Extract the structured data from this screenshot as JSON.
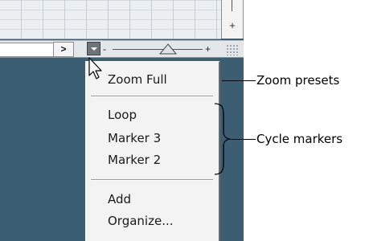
{
  "toolbar": {
    "scroll_right_glyph": ">",
    "zoom_minus": "-",
    "zoom_plus": "+",
    "zoom_level": 0.62,
    "vertical_zoom_plus": "+"
  },
  "menu": {
    "items": [
      {
        "label": "Zoom Full"
      },
      {
        "label": "Loop"
      },
      {
        "label": "Marker 3"
      },
      {
        "label": "Marker 2"
      },
      {
        "label": "Add"
      },
      {
        "label": "Organize..."
      }
    ]
  },
  "callouts": {
    "zoom_presets": "Zoom presets",
    "cycle_markers": "Cycle markers"
  },
  "colors": {
    "project_background": "#3c5e73",
    "menu_background": "#f3f3f3"
  },
  "icons": {
    "cursor": "arrow-pointer-icon",
    "zoom_menu": "triangle-down-icon",
    "zoom_thumb": "triangle-up-icon",
    "resize": "resize-grip-icon"
  }
}
